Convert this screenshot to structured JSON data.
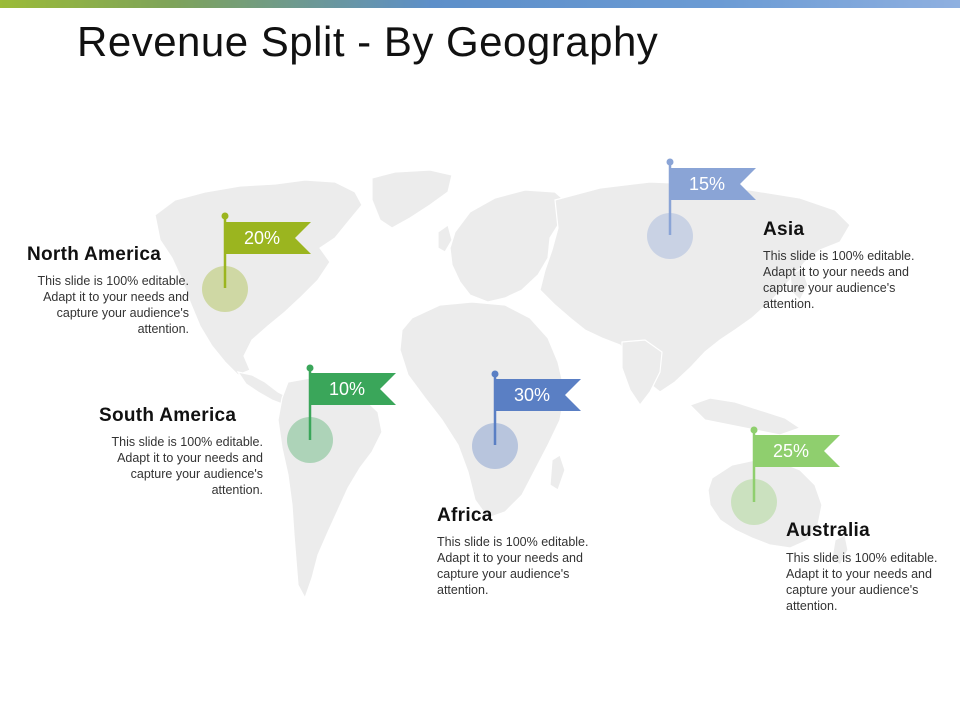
{
  "title": "Revenue Split - By Geography",
  "colors": {
    "north_america": "#9bb51f",
    "south_america": "#3aa65a",
    "africa": "#5a7fc4",
    "asia": "#8aa4d6",
    "australia": "#8fcf6e",
    "map_fill": "#ececec",
    "map_stroke": "#ffffff"
  },
  "regions": [
    {
      "key": "north_america",
      "name": "North America",
      "percent": "20%",
      "value": 20,
      "description": "This slide is 100% editable. Adapt it to your needs and capture your audience's attention."
    },
    {
      "key": "south_america",
      "name": "South America",
      "percent": "10%",
      "value": 10,
      "description": "This slide is 100% editable. Adapt it to your needs and capture your audience's attention."
    },
    {
      "key": "africa",
      "name": "Africa",
      "percent": "30%",
      "value": 30,
      "description": "This slide is 100% editable. Adapt it to your needs and capture your audience's attention."
    },
    {
      "key": "asia",
      "name": "Asia",
      "percent": "15%",
      "value": 15,
      "description": "This slide is 100% editable. Adapt it to your needs and capture your audience's attention."
    },
    {
      "key": "australia",
      "name": "Australia",
      "percent": "25%",
      "value": 25,
      "description": "This slide is 100% editable. Adapt it to your needs and capture your audience's attention."
    }
  ]
}
